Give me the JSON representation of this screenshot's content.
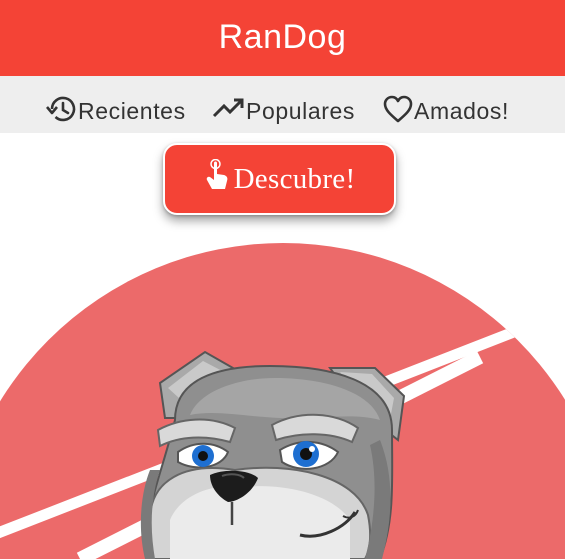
{
  "app": {
    "title": "RanDog",
    "accent_color": "#f44336",
    "circle_color": "#ec6a6a"
  },
  "nav": {
    "items": [
      {
        "id": "recent",
        "label": "Recientes",
        "icon": "history-icon"
      },
      {
        "id": "popular",
        "label": "Populares",
        "icon": "trending-up-icon"
      },
      {
        "id": "loved",
        "label": "Amados!",
        "icon": "heart-outline-icon"
      }
    ]
  },
  "discover": {
    "label": "Descubre!",
    "icon": "pointing-hand-icon"
  },
  "hero": {
    "image": "bulldog-mascot-illustration"
  }
}
